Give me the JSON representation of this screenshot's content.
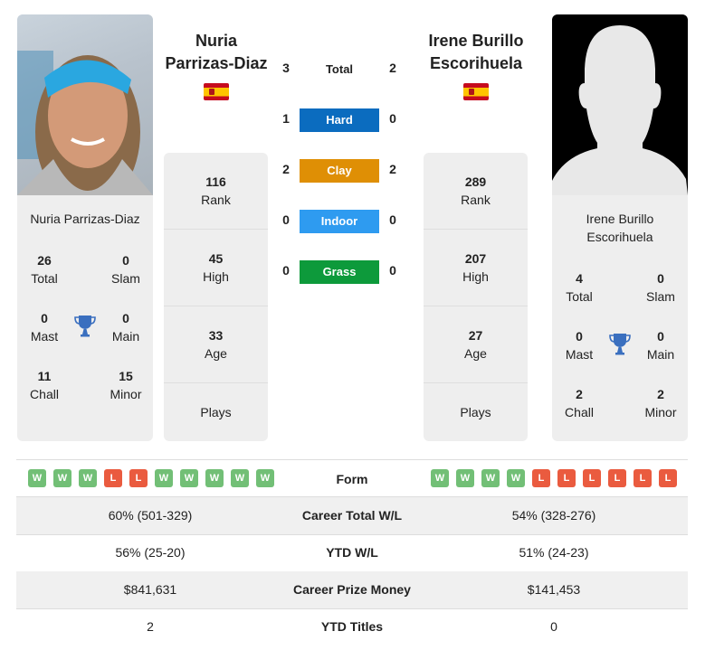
{
  "player1": {
    "name": "Nuria Parrizas-Diaz",
    "name_line1": "Nuria",
    "name_line2": "Parrizas-Diaz",
    "flag": "spain-flag",
    "titles": {
      "total": "26",
      "slam": "0",
      "mast": "0",
      "main": "0",
      "chall": "11",
      "minor": "15"
    },
    "stats": {
      "rank": "116",
      "high": "45",
      "age": "33",
      "plays": ""
    },
    "form": [
      "W",
      "W",
      "W",
      "L",
      "L",
      "W",
      "W",
      "W",
      "W",
      "W"
    ]
  },
  "player2": {
    "name": "Irene Burillo Escorihuela",
    "name_line1": "Irene Burillo",
    "name_line2": "Escorihuela",
    "flag": "spain-flag",
    "titles": {
      "total": "4",
      "slam": "0",
      "mast": "0",
      "main": "0",
      "chall": "2",
      "minor": "2"
    },
    "stats": {
      "rank": "289",
      "high": "207",
      "age": "27",
      "plays": ""
    },
    "form": [
      "W",
      "W",
      "W",
      "W",
      "L",
      "L",
      "L",
      "L",
      "L",
      "L"
    ]
  },
  "labels": {
    "total": "Total",
    "slam": "Slam",
    "mast": "Mast",
    "main": "Main",
    "chall": "Chall",
    "minor": "Minor",
    "rank": "Rank",
    "high": "High",
    "age": "Age",
    "plays": "Plays",
    "form": "Form"
  },
  "h2h": {
    "total": {
      "label": "Total",
      "p1": "3",
      "p2": "2"
    },
    "surfaces": [
      {
        "label": "Hard",
        "p1": "1",
        "p2": "0",
        "color": "#0b6cbf"
      },
      {
        "label": "Clay",
        "p1": "2",
        "p2": "2",
        "color": "#df8f05"
      },
      {
        "label": "Indoor",
        "p1": "0",
        "p2": "0",
        "color": "#2e9bf0"
      },
      {
        "label": "Grass",
        "p1": "0",
        "p2": "0",
        "color": "#0d9a3b"
      }
    ]
  },
  "comparison": [
    {
      "label": "Career Total W/L",
      "p1": "60% (501-329)",
      "p2": "54% (328-276)"
    },
    {
      "label": "YTD W/L",
      "p1": "56% (25-20)",
      "p2": "51% (24-23)"
    },
    {
      "label": "Career Prize Money",
      "p1": "$841,631",
      "p2": "$141,453"
    },
    {
      "label": "YTD Titles",
      "p1": "2",
      "p2": "0"
    }
  ],
  "colors": {
    "win": "#72bf76",
    "loss": "#ea5b3f",
    "trophy": "#3a6fbf"
  }
}
